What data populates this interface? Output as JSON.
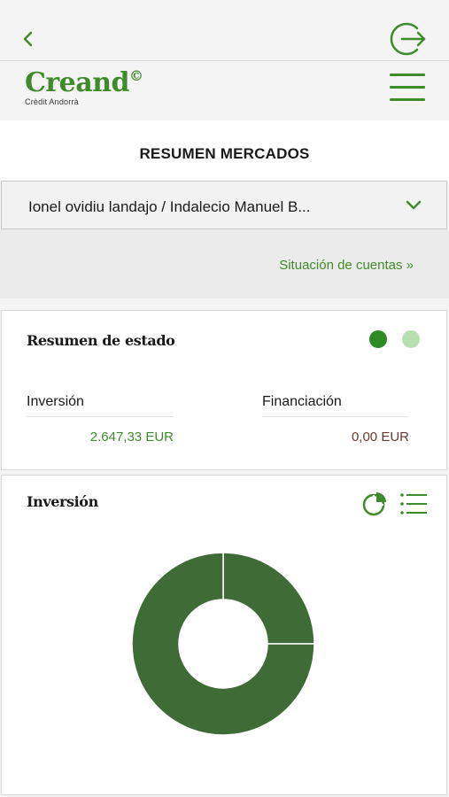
{
  "nav": {
    "back_icon": "chevron-left-icon",
    "logout_icon": "logout-icon",
    "menu_icon": "hamburger-menu-icon"
  },
  "brand": {
    "name": "Creand",
    "mark": "©",
    "subtitle": "Crèdit Andorrà"
  },
  "page": {
    "title": "RESUMEN MERCADOS"
  },
  "account_selector": {
    "value": "Ionel ovidiu landajo / Indalecio Manuel B...",
    "icon": "chevron-down-icon"
  },
  "situacion_link": {
    "label": "Situación de cuentas  »"
  },
  "status_card": {
    "title": "Resumen de estado",
    "pager": {
      "count": 2,
      "active": 1
    },
    "investment": {
      "label": "Inversión",
      "value": "2.647,33 EUR"
    },
    "financing": {
      "label": "Financiación",
      "value": "0,00 EUR"
    }
  },
  "investment_card": {
    "title": "Inversión",
    "view_icons": [
      "pie-chart-icon",
      "list-view-icon"
    ]
  },
  "chart_data": {
    "type": "pie",
    "variant": "donut",
    "title": "",
    "slices": [
      {
        "value": 25
      },
      {
        "value": 75
      }
    ]
  },
  "colors": {
    "brand_green": "#3f8b2b",
    "positive_value": "#3f8b2b",
    "neutral_value": "#6b3a2e",
    "dot_active": "#2e8b23",
    "dot_inactive": "#b9e0b5",
    "donut": "#3f6b37"
  }
}
